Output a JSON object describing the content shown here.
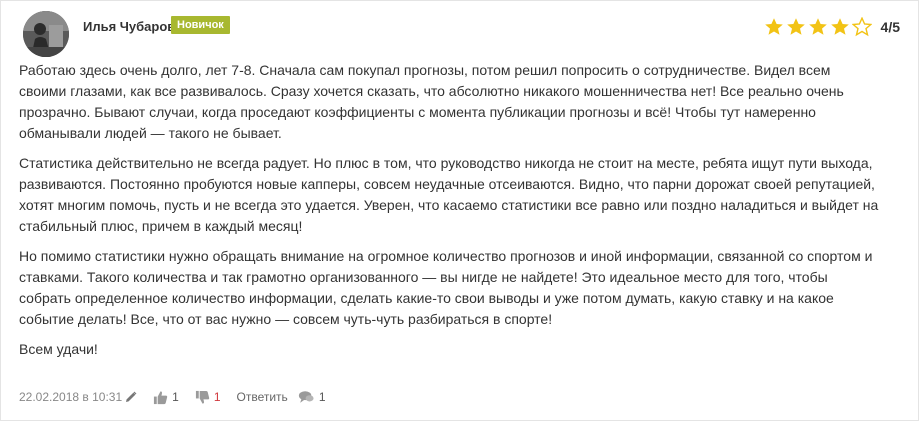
{
  "review": {
    "author": "Илья Чубаров",
    "badge": "Новичок",
    "rating": {
      "value": 4,
      "max": 5,
      "label": "4/5"
    },
    "paragraphs": [
      "Работаю здесь очень долго, лет 7-8. Сначала сам покупал прогнозы, потом решил попросить о сотрудничестве. Видел всем своими глазами, как все развивалось. Сразу хочется сказать, что абсолютно никакого мошенничества нет! Все реально очень прозрачно. Бывают случаи, когда проседают коэффициенты с момента публикации прогнозы и всё! Чтобы тут намеренно обманывали людей — такого не бывает.",
      "Статистика действительно не всегда радует. Но плюс в том, что руководство никогда не стоит на месте, ребята ищут пути выхода, развиваются. Постоянно пробуются новые капперы, совсем неудачные отсеиваются. Видно, что парни дорожат своей репутацией, хотят многим помочь, пусть и не всегда это удается. Уверен, что касаемо статистики все равно или поздно наладиться и выйдет на стабильный плюс, причем в каждый месяц!",
      "Но помимо статистики нужно обращать внимание на огромное количество прогнозов и иной информации, связанной со спортом и ставками. Такого количества и так грамотно организованного — вы нигде не найдете! Это идеальное место для того, чтобы собрать определенное количество информации, сделать какие-то свои выводы и уже потом думать, какую ставку и на какое событие делать! Все, что от вас нужно — совсем чуть-чуть разбираться в спорте!",
      "Всем удачи!"
    ],
    "footer": {
      "date": "22.02.2018 в 10:31",
      "likes": "1",
      "dislikes": "1",
      "reply_label": "Ответить",
      "comments": "1"
    }
  },
  "colors": {
    "badge_bg": "#a8b830",
    "star_filled": "#f2c315",
    "star_empty": "#f2c315",
    "dislike": "#d0383d"
  },
  "icons": [
    "edit-pencil-icon",
    "thumbs-up-icon",
    "thumbs-down-icon",
    "comment-bubble-icon"
  ]
}
